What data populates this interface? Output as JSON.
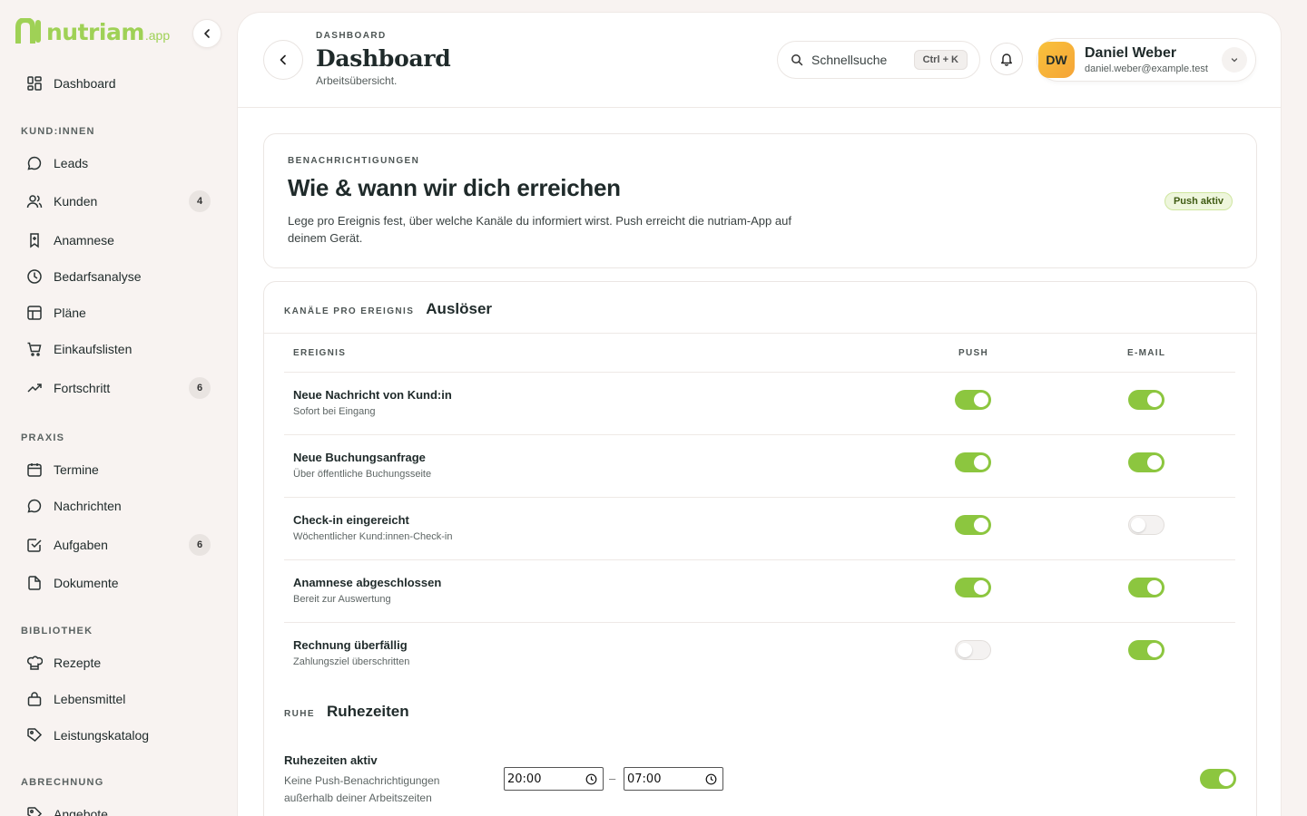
{
  "brand": {
    "name": "nutriam",
    "suffix": ".app",
    "color": "#9fd156"
  },
  "sidebar": {
    "dashboard": "Dashboard",
    "sections": [
      {
        "title": "KUND:INNEN"
      },
      {
        "title": "PRAXIS"
      },
      {
        "title": "BIBLIOTHEK"
      },
      {
        "title": "ABRECHNUNG"
      }
    ],
    "items": [
      {
        "label": "Leads",
        "icon": "chat-icon"
      },
      {
        "label": "Kunden",
        "icon": "users-icon",
        "badge": "4"
      },
      {
        "label": "Anamnese",
        "icon": "clipboard-icon"
      },
      {
        "label": "Bedarfsanalyse",
        "icon": "clock-icon"
      },
      {
        "label": "Pläne",
        "icon": "table-icon"
      },
      {
        "label": "Einkaufslisten",
        "icon": "cart-icon"
      },
      {
        "label": "Fortschritt",
        "icon": "trend-icon",
        "badge": "6"
      },
      {
        "label": "Termine",
        "icon": "calendar-icon"
      },
      {
        "label": "Nachrichten",
        "icon": "message-icon"
      },
      {
        "label": "Aufgaben",
        "icon": "check-square-icon",
        "badge": "6"
      },
      {
        "label": "Dokumente",
        "icon": "document-icon"
      },
      {
        "label": "Rezepte",
        "icon": "chef-hat-icon"
      },
      {
        "label": "Lebensmittel",
        "icon": "basket-icon"
      },
      {
        "label": "Leistungskatalog",
        "icon": "tag-icon"
      },
      {
        "label": "Angebote",
        "icon": "tag-icon"
      }
    ]
  },
  "header": {
    "breadcrumb": "DASHBOARD",
    "title": "Dashboard",
    "subtitle": "Arbeitsübersicht.",
    "search_label": "Schnellsuche",
    "shortcut": "Ctrl + K",
    "user": {
      "initials": "DW",
      "name": "Daniel Weber",
      "email": "daniel.weber@example.test"
    }
  },
  "notifications": {
    "overline": "BENACHRICHTIGUNGEN",
    "title": "Wie & wann wir dich erreichen",
    "description": "Lege pro Ereignis fest, über welche Kanäle du informiert wirst. Push erreicht die nutriam-App auf deinem Gerät.",
    "badge": "Push aktiv"
  },
  "channels": {
    "overline": "KANÄLE PRO EREIGNIS",
    "title": "Auslöser",
    "columns": {
      "event": "EREIGNIS",
      "push": "PUSH",
      "email": "E-MAIL"
    },
    "rows": [
      {
        "title": "Neue Nachricht von Kund:in",
        "sub": "Sofort bei Eingang",
        "push": true,
        "email": true
      },
      {
        "title": "Neue Buchungsanfrage",
        "sub": "Über öffentliche Buchungsseite",
        "push": true,
        "email": true
      },
      {
        "title": "Check-in eingereicht",
        "sub": "Wöchentlicher Kund:innen-Check-in",
        "push": true,
        "email": false
      },
      {
        "title": "Anamnese abgeschlossen",
        "sub": "Bereit zur Auswertung",
        "push": true,
        "email": true
      },
      {
        "title": "Rechnung überfällig",
        "sub": "Zahlungsziel überschritten",
        "push": false,
        "email": true
      }
    ]
  },
  "quiet": {
    "overline": "RUHE",
    "title": "Ruhezeiten",
    "label": "Ruhezeiten aktiv",
    "description": "Keine Push-Benachrichtigungen außerhalb deiner Arbeitszeiten",
    "from": "20:00",
    "to": "07:00",
    "enabled": true
  },
  "colors": {
    "accent": "#8cc63f",
    "avatar": "#f9c23c"
  }
}
